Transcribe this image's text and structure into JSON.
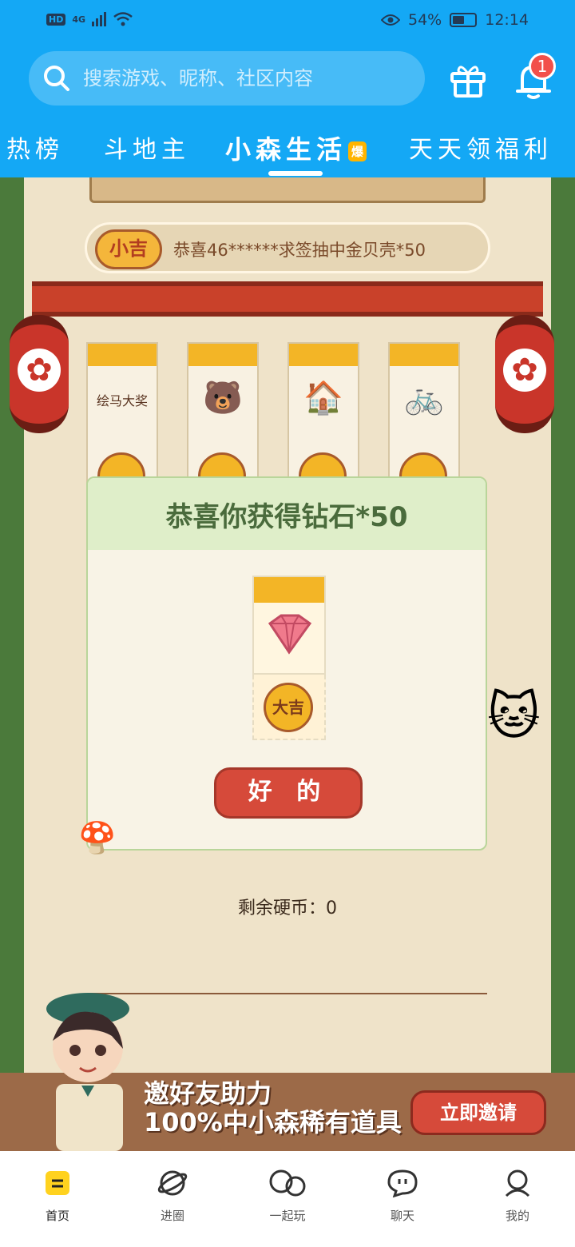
{
  "status_bar": {
    "left_badges": [
      "HD",
      "4G"
    ],
    "battery": "54%",
    "time": "12:14"
  },
  "search": {
    "placeholder": "搜索游戏、昵称、社区内容"
  },
  "notifications": {
    "badge_count": "1"
  },
  "tabs": [
    {
      "label": "热榜",
      "active": false
    },
    {
      "label": "斗地主",
      "active": false
    },
    {
      "label": "小森生活",
      "active": true,
      "badge": "爆"
    },
    {
      "label": "天天领福利",
      "active": false
    }
  ],
  "game": {
    "ticker_badge": "小吉",
    "ticker_text": "恭喜46******求签抽中金贝壳*50",
    "card_label": "绘马大奖",
    "coins_left": "剩余硬币：0",
    "invite_text_line1": "邀好友助力",
    "invite_text_line2": "100%中小森稀有道具",
    "invite_button": "立即邀请"
  },
  "modal": {
    "title": "恭喜你获得钻石*50",
    "coin_label": "大吉",
    "ok_button": "好 的"
  },
  "bottom_nav": [
    {
      "label": "首页",
      "icon": "home-icon",
      "active": true
    },
    {
      "label": "进圈",
      "icon": "planet-icon",
      "active": false
    },
    {
      "label": "一起玩",
      "icon": "group-icon",
      "active": false
    },
    {
      "label": "聊天",
      "icon": "chat-icon",
      "active": false
    },
    {
      "label": "我的",
      "icon": "profile-icon",
      "active": false
    }
  ],
  "colors": {
    "brand_blue": "#14a8f5",
    "accent_red": "#d64a3a",
    "gold": "#f3b526"
  }
}
